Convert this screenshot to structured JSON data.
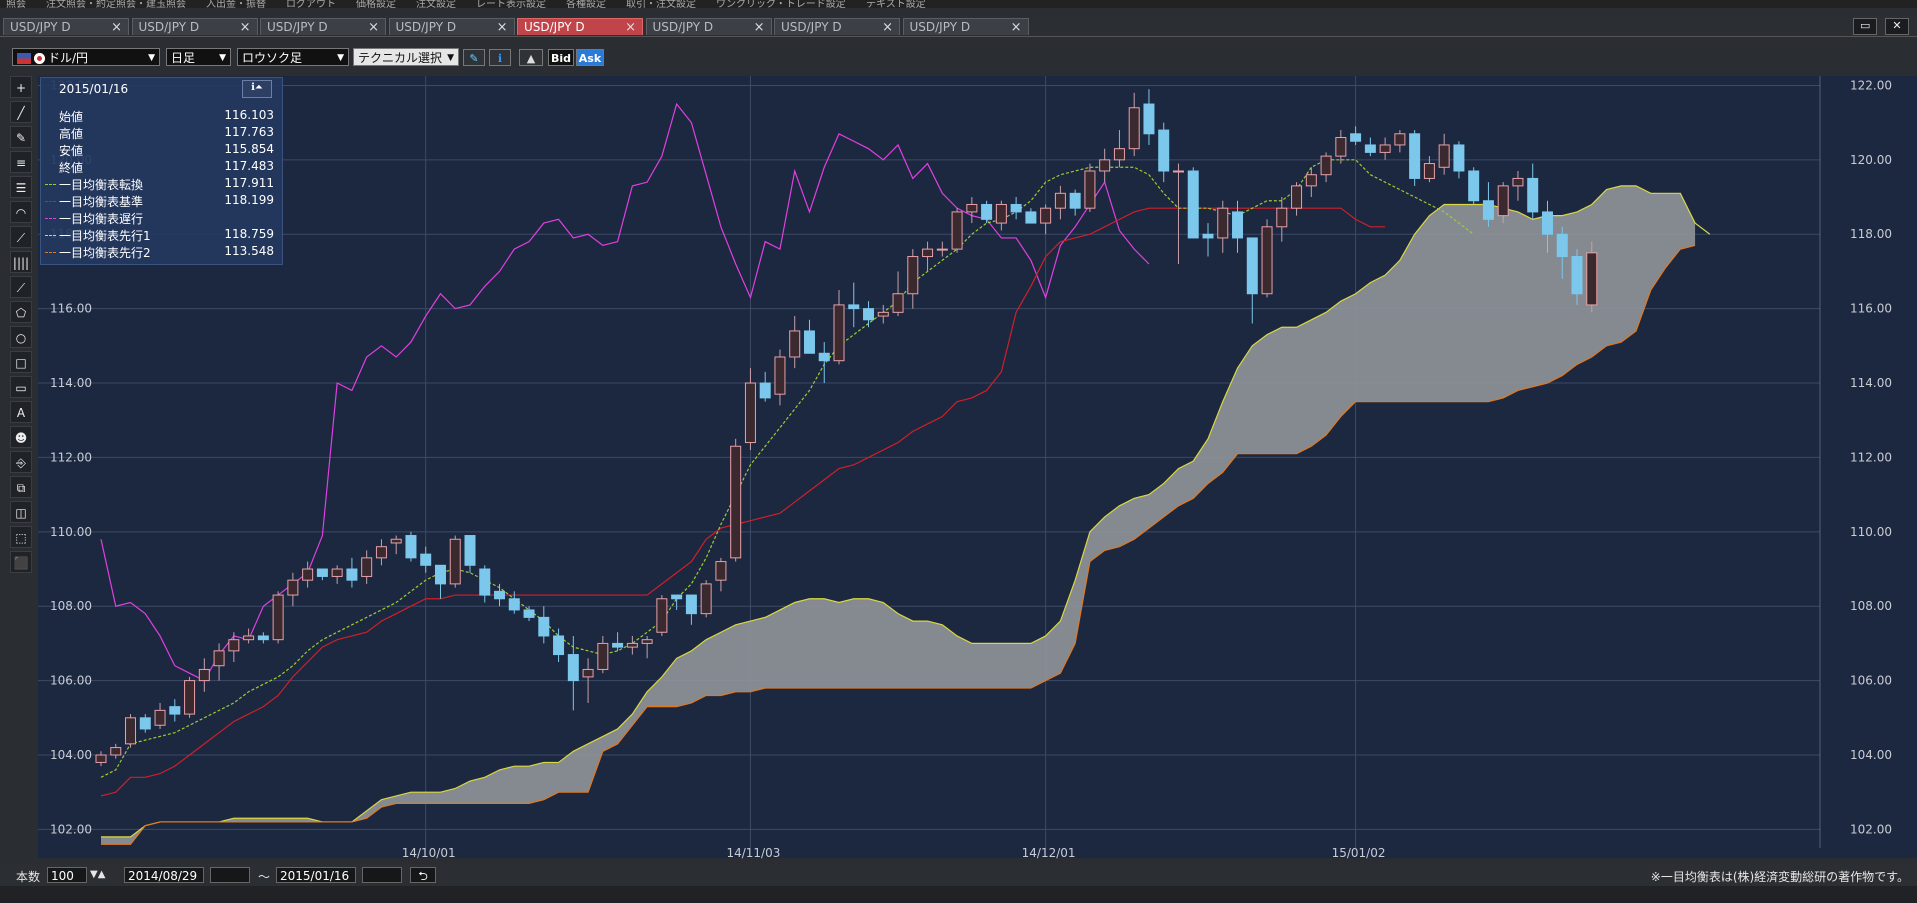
{
  "menubar": {
    "items": [
      "照会",
      "注文照会・約定照会・建玉照会",
      "入出金・振替",
      "ログアウト",
      "価格設定",
      "注文設定",
      "レート表示設定",
      "各種設定",
      "取引・注文設定",
      "ワンクリック・トレード設定",
      "テキスト設定"
    ]
  },
  "tabs": [
    {
      "label": "USD/JPY D",
      "close": "×",
      "active": false
    },
    {
      "label": "USD/JPY D",
      "close": "×",
      "active": false
    },
    {
      "label": "USD/JPY D",
      "close": "×",
      "active": false
    },
    {
      "label": "USD/JPY D",
      "close": "×",
      "active": false
    },
    {
      "label": "USD/JPY D",
      "close": "×",
      "active": true
    },
    {
      "label": "USD/JPY D",
      "close": "×",
      "active": false
    },
    {
      "label": "USD/JPY D",
      "close": "×",
      "active": false
    },
    {
      "label": "USD/JPY D",
      "close": "×",
      "active": false
    }
  ],
  "window_controls": {
    "restore": "▭",
    "close": "✕"
  },
  "toolbar": {
    "symbol": "ドル/円",
    "timeframe": "日足",
    "chart_type": "ロウソク足",
    "technical": "テクニカル選択",
    "bid": "Bid",
    "ask": "Ask"
  },
  "tools": [
    "+",
    "╱",
    "✎",
    "≡",
    "☰",
    "◠",
    "⟋",
    "||||",
    "⟋",
    "⬠",
    "○",
    "□",
    "▭",
    "A",
    "☻",
    "⎆",
    "⧉",
    "◫",
    "⬚",
    "⬛"
  ],
  "info": {
    "date": "2015/01/16",
    "icons": "ℹ⏶",
    "rows": [
      {
        "label": "始値",
        "value": "116.103",
        "swatch": ""
      },
      {
        "label": "高値",
        "value": "117.763",
        "swatch": ""
      },
      {
        "label": "安値",
        "value": "115.854",
        "swatch": ""
      },
      {
        "label": "終値",
        "value": "117.483",
        "swatch": ""
      },
      {
        "label": "一目均衡表転換",
        "value": "117.911",
        "swatch": "#9acd32"
      },
      {
        "label": "一目均衡表基準",
        "value": "118.199",
        "swatch": "#d0202a"
      },
      {
        "label": "一目均衡表遅行",
        "value": "",
        "swatch": "#e040e0"
      },
      {
        "label": "一目均衡表先行1",
        "value": "118.759",
        "swatch": "#d8d840"
      },
      {
        "label": "一目均衡表先行2",
        "value": "113.548",
        "swatch": "#e07820"
      }
    ]
  },
  "bottom": {
    "count_label": "本数",
    "count": "100",
    "start": "2014/08/29",
    "tilde": "～",
    "end": "2015/01/16",
    "reset": "⮌",
    "copyright": "※一目均衡表は(株)経済変動総研の著作物です。"
  },
  "colors": {
    "background": "#1c2740",
    "up_candle": "#e8a0a8",
    "down_candle": "#7cc8ec",
    "tenkan": "#9acd32",
    "kijun": "#d0202a",
    "chikou": "#e040e0",
    "senkou_a": "#d8d840",
    "senkou_b": "#e07820",
    "cloud": "#8e9298"
  },
  "chart_data": {
    "type": "candlestick",
    "ylim": [
      101.5,
      122.2
    ],
    "yticks": [
      "102.00",
      "104.00",
      "106.00",
      "108.00",
      "110.00",
      "112.00",
      "114.00",
      "116.00",
      "118.00",
      "120.00",
      "122.00"
    ],
    "x_labels": [
      {
        "label": "14/10/01",
        "index": 22
      },
      {
        "label": "14/11/03",
        "index": 44
      },
      {
        "label": "14/12/01",
        "index": 64
      },
      {
        "label": "15/01/02",
        "index": 85
      }
    ],
    "candles": [
      [
        103.8,
        104.1,
        103.7,
        104.0
      ],
      [
        104.0,
        104.3,
        103.9,
        104.2
      ],
      [
        104.3,
        105.1,
        104.2,
        105.0
      ],
      [
        105.0,
        105.1,
        104.6,
        104.7
      ],
      [
        104.8,
        105.4,
        104.7,
        105.2
      ],
      [
        105.3,
        105.5,
        104.9,
        105.1
      ],
      [
        105.1,
        106.1,
        105.0,
        106.0
      ],
      [
        106.0,
        106.6,
        105.7,
        106.3
      ],
      [
        106.4,
        107.0,
        106.0,
        106.8
      ],
      [
        106.8,
        107.3,
        106.5,
        107.1
      ],
      [
        107.1,
        107.4,
        107.0,
        107.2
      ],
      [
        107.2,
        107.3,
        107.0,
        107.1
      ],
      [
        107.1,
        108.4,
        107.0,
        108.3
      ],
      [
        108.3,
        108.9,
        108.0,
        108.7
      ],
      [
        108.7,
        109.2,
        108.5,
        109.0
      ],
      [
        109.0,
        109.0,
        108.7,
        108.8
      ],
      [
        108.8,
        109.1,
        108.6,
        109.0
      ],
      [
        109.0,
        109.3,
        108.5,
        108.7
      ],
      [
        108.8,
        109.5,
        108.6,
        109.3
      ],
      [
        109.3,
        109.8,
        109.1,
        109.6
      ],
      [
        109.7,
        109.9,
        109.4,
        109.8
      ],
      [
        109.9,
        110.0,
        109.2,
        109.3
      ],
      [
        109.4,
        109.6,
        108.9,
        109.1
      ],
      [
        109.1,
        109.1,
        108.2,
        108.6
      ],
      [
        108.6,
        109.9,
        108.5,
        109.8
      ],
      [
        109.9,
        109.9,
        108.9,
        109.1
      ],
      [
        109.0,
        109.1,
        108.1,
        108.3
      ],
      [
        108.4,
        108.6,
        108.0,
        108.2
      ],
      [
        108.2,
        108.4,
        107.8,
        107.9
      ],
      [
        107.9,
        108.0,
        107.6,
        107.7
      ],
      [
        107.7,
        108.0,
        107.0,
        107.2
      ],
      [
        107.2,
        107.4,
        106.5,
        106.7
      ],
      [
        106.7,
        107.2,
        105.2,
        106.0
      ],
      [
        106.1,
        106.6,
        105.4,
        106.3
      ],
      [
        106.3,
        107.2,
        106.2,
        107.0
      ],
      [
        107.0,
        107.3,
        106.8,
        106.9
      ],
      [
        106.9,
        107.2,
        106.7,
        107.0
      ],
      [
        107.0,
        107.2,
        106.6,
        107.1
      ],
      [
        107.3,
        108.3,
        107.2,
        108.2
      ],
      [
        108.3,
        108.3,
        107.9,
        108.2
      ],
      [
        108.3,
        108.3,
        107.5,
        107.8
      ],
      [
        107.8,
        108.7,
        107.7,
        108.6
      ],
      [
        108.7,
        109.3,
        108.4,
        109.2
      ],
      [
        109.3,
        112.5,
        109.2,
        112.3
      ],
      [
        112.4,
        114.4,
        112.2,
        114.0
      ],
      [
        114.0,
        114.3,
        113.5,
        113.6
      ],
      [
        113.7,
        114.9,
        113.4,
        114.7
      ],
      [
        114.7,
        115.8,
        114.4,
        115.4
      ],
      [
        115.4,
        115.7,
        114.8,
        114.8
      ],
      [
        114.8,
        115.1,
        114.0,
        114.6
      ],
      [
        114.6,
        116.5,
        114.5,
        116.1
      ],
      [
        116.1,
        116.7,
        115.5,
        116.0
      ],
      [
        116.0,
        116.2,
        115.5,
        115.7
      ],
      [
        115.8,
        116.1,
        115.6,
        115.9
      ],
      [
        115.9,
        117.0,
        115.8,
        116.4
      ],
      [
        116.4,
        117.6,
        116.0,
        117.4
      ],
      [
        117.4,
        117.8,
        117.0,
        117.6
      ],
      [
        117.6,
        117.8,
        117.4,
        117.6
      ],
      [
        117.6,
        118.7,
        117.5,
        118.6
      ],
      [
        118.6,
        119.0,
        118.3,
        118.8
      ],
      [
        118.8,
        118.9,
        118.3,
        118.4
      ],
      [
        118.3,
        118.9,
        118.1,
        118.8
      ],
      [
        118.8,
        119.0,
        118.4,
        118.6
      ],
      [
        118.6,
        118.7,
        118.3,
        118.3
      ],
      [
        118.3,
        118.8,
        118.0,
        118.7
      ],
      [
        118.7,
        119.3,
        118.4,
        119.1
      ],
      [
        119.1,
        119.2,
        118.5,
        118.7
      ],
      [
        118.7,
        119.9,
        118.6,
        119.7
      ],
      [
        119.7,
        120.3,
        119.4,
        120.0
      ],
      [
        120.0,
        120.8,
        119.8,
        120.3
      ],
      [
        120.3,
        121.8,
        120.1,
        121.4
      ],
      [
        121.5,
        121.9,
        120.4,
        120.7
      ],
      [
        120.8,
        121.0,
        119.4,
        119.7
      ],
      [
        119.7,
        119.9,
        117.2,
        119.7
      ],
      [
        119.7,
        119.8,
        117.9,
        117.9
      ],
      [
        118.0,
        118.3,
        117.4,
        117.9
      ],
      [
        117.9,
        118.9,
        117.5,
        118.7
      ],
      [
        118.6,
        118.9,
        117.5,
        117.9
      ],
      [
        117.9,
        117.9,
        115.6,
        116.4
      ],
      [
        116.4,
        118.4,
        116.3,
        118.2
      ],
      [
        118.2,
        119.0,
        117.8,
        118.7
      ],
      [
        118.7,
        119.4,
        118.5,
        119.3
      ],
      [
        119.3,
        119.8,
        119.0,
        119.6
      ],
      [
        119.6,
        120.2,
        119.4,
        120.1
      ],
      [
        120.1,
        120.8,
        119.9,
        120.6
      ],
      [
        120.7,
        120.9,
        120.4,
        120.5
      ],
      [
        120.4,
        120.6,
        120.1,
        120.2
      ],
      [
        120.2,
        120.6,
        120.0,
        120.4
      ],
      [
        120.4,
        120.8,
        120.2,
        120.7
      ],
      [
        120.7,
        120.8,
        119.3,
        119.5
      ],
      [
        119.5,
        120.1,
        119.4,
        119.9
      ],
      [
        119.8,
        120.7,
        119.6,
        120.4
      ],
      [
        120.4,
        120.5,
        119.5,
        119.7
      ],
      [
        119.7,
        119.8,
        118.8,
        118.9
      ],
      [
        118.9,
        119.4,
        118.2,
        118.4
      ],
      [
        118.5,
        119.4,
        118.3,
        119.3
      ],
      [
        119.3,
        119.7,
        118.9,
        119.5
      ],
      [
        119.5,
        119.9,
        118.4,
        118.6
      ],
      [
        118.6,
        118.9,
        117.5,
        118.0
      ],
      [
        118.0,
        118.2,
        116.8,
        117.4
      ],
      [
        117.4,
        117.6,
        116.1,
        116.4
      ],
      [
        116.1,
        117.8,
        115.9,
        117.5
      ]
    ],
    "tenkan": [
      103.4,
      103.6,
      104.3,
      104.4,
      104.5,
      104.6,
      104.8,
      105.0,
      105.2,
      105.4,
      105.7,
      105.9,
      106.1,
      106.4,
      106.8,
      107.1,
      107.3,
      107.5,
      107.7,
      107.9,
      108.1,
      108.4,
      108.7,
      108.9,
      109.0,
      108.9,
      108.7,
      108.5,
      108.2,
      107.9,
      107.6,
      107.2,
      106.9,
      106.8,
      106.7,
      106.8,
      107.0,
      107.3,
      107.6,
      108.2,
      108.6,
      109.3,
      110.2,
      111.0,
      111.8,
      112.3,
      112.8,
      113.3,
      113.8,
      114.5,
      115.0,
      115.3,
      115.6,
      115.9,
      116.2,
      116.7,
      117.0,
      117.3,
      117.6,
      118.0,
      118.3,
      118.4,
      118.6,
      118.9,
      119.4,
      119.6,
      119.7,
      119.8,
      119.8,
      119.8,
      119.8,
      119.6,
      119.1,
      118.7,
      118.7,
      118.7,
      118.6,
      118.5,
      118.7,
      118.9,
      118.9,
      119.2,
      119.8,
      120.0,
      120.0,
      120.0,
      119.6,
      119.4,
      119.2,
      119.0,
      118.8,
      118.6,
      118.3,
      118.0
    ],
    "kijun": [
      102.9,
      103.0,
      103.4,
      103.4,
      103.5,
      103.7,
      104.0,
      104.3,
      104.6,
      104.9,
      105.1,
      105.3,
      105.6,
      106.1,
      106.5,
      106.9,
      107.1,
      107.2,
      107.3,
      107.6,
      107.8,
      108.0,
      108.2,
      108.2,
      108.3,
      108.3,
      108.3,
      108.3,
      108.3,
      108.3,
      108.3,
      108.3,
      108.3,
      108.3,
      108.3,
      108.3,
      108.3,
      108.3,
      108.6,
      108.9,
      109.2,
      109.8,
      110.1,
      110.2,
      110.3,
      110.4,
      110.5,
      110.8,
      111.1,
      111.4,
      111.7,
      111.8,
      112.0,
      112.2,
      112.4,
      112.7,
      112.9,
      113.1,
      113.5,
      113.6,
      113.8,
      114.3,
      115.9,
      116.6,
      117.4,
      117.8,
      117.9,
      118.0,
      118.2,
      118.4,
      118.6,
      118.7,
      118.7,
      118.7,
      118.7,
      118.7,
      118.7,
      118.7,
      118.7,
      118.7,
      118.7,
      118.7,
      118.7,
      118.7,
      118.7,
      118.4,
      118.2,
      118.2
    ],
    "chikou": [
      109.8,
      108.0,
      108.1,
      107.8,
      107.2,
      106.4,
      106.2,
      106.0,
      106.7,
      107.2,
      107.1,
      108.0,
      108.3,
      108.6,
      108.9,
      109.9,
      114.0,
      113.8,
      114.7,
      115.0,
      114.7,
      115.1,
      115.8,
      116.4,
      116.0,
      116.1,
      116.6,
      117.0,
      117.6,
      117.8,
      118.3,
      118.4,
      117.9,
      118.0,
      117.7,
      117.8,
      119.3,
      119.4,
      120.1,
      121.5,
      121.0,
      119.6,
      118.2,
      117.2,
      116.3,
      117.8,
      117.6,
      119.7,
      118.6,
      119.8,
      120.7,
      120.5,
      120.3,
      120.0,
      120.4,
      119.5,
      119.9,
      119.1,
      118.7,
      118.5,
      118.4,
      117.9,
      117.9,
      117.3,
      116.3,
      117.7,
      118.2,
      118.8,
      119.4,
      118.1,
      117.6,
      117.2
    ],
    "senkou_a": [
      101.8,
      101.8,
      101.8,
      102.1,
      102.2,
      102.2,
      102.2,
      102.2,
      102.2,
      102.3,
      102.3,
      102.3,
      102.3,
      102.3,
      102.3,
      102.2,
      102.2,
      102.2,
      102.5,
      102.8,
      102.9,
      103.0,
      103.0,
      103.0,
      103.1,
      103.3,
      103.4,
      103.6,
      103.7,
      103.7,
      103.8,
      103.8,
      104.1,
      104.3,
      104.5,
      104.7,
      105.1,
      105.7,
      106.1,
      106.6,
      106.8,
      107.1,
      107.3,
      107.5,
      107.6,
      107.7,
      107.9,
      108.1,
      108.2,
      108.2,
      108.1,
      108.2,
      108.2,
      108.1,
      107.8,
      107.6,
      107.6,
      107.5,
      107.2,
      107.0,
      107.0,
      107.0,
      107.0,
      107.0,
      107.2,
      107.6,
      108.7,
      110.0,
      110.4,
      110.7,
      110.9,
      111.0,
      111.3,
      111.7,
      111.9,
      112.5,
      113.5,
      114.4,
      115.0,
      115.3,
      115.5,
      115.5,
      115.7,
      115.9,
      116.2,
      116.4,
      116.7,
      116.9,
      117.3,
      118.0,
      118.5,
      118.8,
      118.8,
      118.8,
      118.8,
      118.7,
      118.6,
      118.4,
      118.5,
      118.5,
      118.6,
      118.8,
      119.2,
      119.3,
      119.3,
      119.1,
      119.1,
      119.1,
      118.3,
      118.0
    ],
    "senkou_b": [
      101.6,
      101.6,
      101.6,
      102.1,
      102.2,
      102.2,
      102.2,
      102.2,
      102.2,
      102.2,
      102.2,
      102.2,
      102.2,
      102.2,
      102.2,
      102.2,
      102.2,
      102.2,
      102.3,
      102.6,
      102.7,
      102.7,
      102.7,
      102.7,
      102.7,
      102.7,
      102.7,
      102.7,
      102.7,
      102.7,
      102.8,
      103.0,
      103.0,
      103.0,
      104.1,
      104.3,
      104.8,
      105.3,
      105.3,
      105.3,
      105.4,
      105.6,
      105.6,
      105.7,
      105.7,
      105.8,
      105.8,
      105.8,
      105.8,
      105.8,
      105.8,
      105.8,
      105.8,
      105.8,
      105.8,
      105.8,
      105.8,
      105.8,
      105.8,
      105.8,
      105.8,
      105.8,
      105.8,
      105.8,
      106.0,
      106.2,
      107.0,
      109.2,
      109.5,
      109.6,
      109.8,
      110.1,
      110.4,
      110.7,
      110.9,
      111.3,
      111.6,
      112.1,
      112.1,
      112.1,
      112.1,
      112.1,
      112.3,
      112.6,
      113.1,
      113.5,
      113.5,
      113.5,
      113.5,
      113.5,
      113.5,
      113.5,
      113.5,
      113.5,
      113.5,
      113.6,
      113.8,
      113.9,
      114.0,
      114.2,
      114.5,
      114.7,
      115.0,
      115.1,
      115.4,
      116.5,
      117.1,
      117.6,
      117.7
    ]
  }
}
